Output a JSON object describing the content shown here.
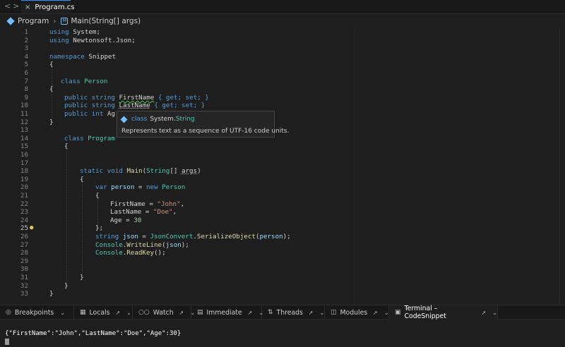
{
  "titlebar": {
    "nav_back": "<",
    "nav_forward": ">",
    "tab_close": "×",
    "tab_label": "Program.cs"
  },
  "breadcrumb": {
    "class_name": "Program",
    "separator": "›",
    "method_icon": "M",
    "method": "Main(String[] args)"
  },
  "editor": {
    "active_line": 25,
    "line_numbers": [
      "1",
      "2",
      "3",
      "4",
      "5",
      "6",
      "7",
      "8",
      "9",
      "10",
      "11",
      "12",
      "13",
      "14",
      "15",
      "16",
      "17",
      "18",
      "19",
      "20",
      "21",
      "22",
      "23",
      "24",
      "25",
      "26",
      "27",
      "28",
      "29",
      "30",
      "31",
      "32",
      "33"
    ]
  },
  "code": {
    "using": "using",
    "system": "System;",
    "newtonsoft": "Newtonsoft.Json;",
    "namespace": "namespace",
    "snippet": "Snippet",
    "brace_open": "{",
    "brace_close": "}",
    "brace_close_semi": "};",
    "class": "class",
    "person": "Person",
    "public": "public",
    "string": "string",
    "int": "int",
    "firstname": "FirstName",
    "lastname": "LastName",
    "age_partial": "Ag",
    "accessors": "{ get; set; }",
    "program": "Program",
    "static": "static",
    "void": "void",
    "main": "Main",
    "paren_open": "(",
    "string_type": "String",
    "array_sep": "[] ",
    "args": "args",
    "paren_close": ")",
    "var": "var",
    "person_var": "person",
    "assign": " = ",
    "new": "new",
    "firstname_prop": "FirstName",
    "eq": " = ",
    "john": "\"John\"",
    "comma": ",",
    "lastname_prop": "LastName",
    "doe": "\"Doe\"",
    "age_prop": "Age",
    "age_val": "30",
    "json_var": "json",
    "jsonconvert": "JsonConvert",
    "dot": ".",
    "serialize": "SerializeObject",
    "person_arg": "person",
    "close_semi": ");",
    "console": "Console",
    "writeline": "WriteLine",
    "json_arg": "json",
    "readkey": "ReadKey",
    "empty_call": "();"
  },
  "tooltip": {
    "kind": "class",
    "namespace": "System.",
    "class_name": "String",
    "doc": "Represents text as a sequence of UTF-16 code units."
  },
  "panel_tabs": [
    {
      "label": "Breakpoints",
      "icon": "breakpoint-icon"
    },
    {
      "label": "Locals",
      "icon": "locals-icon"
    },
    {
      "label": "Watch",
      "icon": "watch-icon"
    },
    {
      "label": "Immediate",
      "icon": "immediate-icon"
    },
    {
      "label": "Threads",
      "icon": "threads-icon"
    },
    {
      "label": "Modules",
      "icon": "modules-icon"
    },
    {
      "label": "Terminal – CodeSnippet",
      "icon": "terminal-icon"
    }
  ],
  "terminal": {
    "output": "{\"FirstName\":\"John\",\"LastName\":\"Doe\",\"Age\":30}"
  },
  "colors": {
    "keyword": "#569cd6",
    "type": "#4ec9b0",
    "string": "#ce9178",
    "number": "#b5cea8",
    "method": "#dcdcaa",
    "variable": "#9cdcfe",
    "background": "#1e1e1e"
  }
}
